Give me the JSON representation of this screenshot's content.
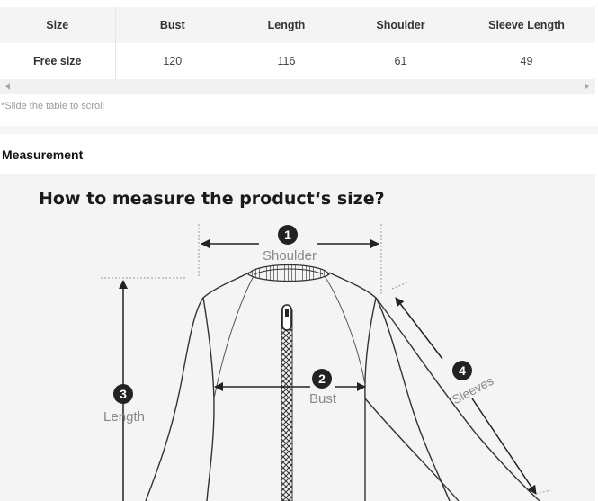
{
  "size_table": {
    "headers": [
      "Size",
      "Bust",
      "Length",
      "Shoulder",
      "Sleeve Length"
    ],
    "rows": [
      [
        "Free size",
        "120",
        "116",
        "61",
        "49"
      ]
    ]
  },
  "scroll_hint": "*Slide the table to scroll",
  "measurement": {
    "section_title": "Measurement",
    "heading": "How to measure the product‘s size?",
    "labels": {
      "shoulder": {
        "num": "1",
        "text": "Shoulder"
      },
      "bust": {
        "num": "2",
        "text": "Bust"
      },
      "length": {
        "num": "3",
        "text": "Length"
      },
      "sleeves": {
        "num": "4",
        "text": "Sleeves"
      }
    }
  },
  "icons": [
    "scroll-left-arrow-icon",
    "scroll-right-arrow-icon",
    "jacket-diagram"
  ]
}
